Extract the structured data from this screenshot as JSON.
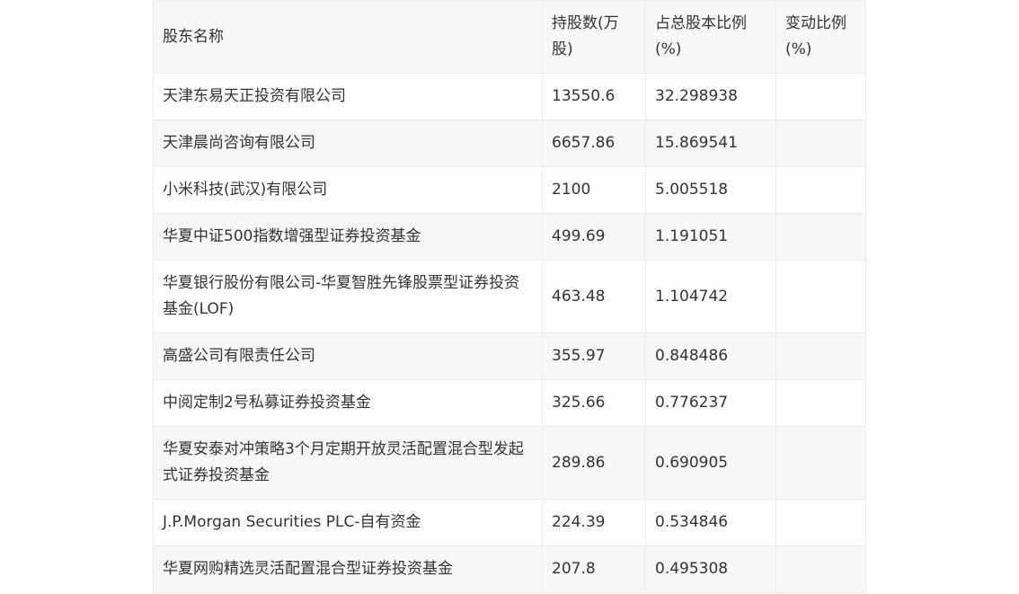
{
  "table": {
    "headers": [
      "股东名称",
      "持股数(万股)",
      "占总股本比例(%)",
      "变动比例(%)"
    ],
    "rows": [
      [
        "天津东易天正投资有限公司",
        "13550.6",
        "32.298938",
        ""
      ],
      [
        "天津晨尚咨询有限公司",
        "6657.86",
        "15.869541",
        ""
      ],
      [
        "小米科技(武汉)有限公司",
        "2100",
        "5.005518",
        ""
      ],
      [
        "华夏中证500指数增强型证券投资基金",
        "499.69",
        "1.191051",
        ""
      ],
      [
        "华夏银行股份有限公司-华夏智胜先锋股票型证券投资基金(LOF)",
        "463.48",
        "1.104742",
        ""
      ],
      [
        "高盛公司有限责任公司",
        "355.97",
        "0.848486",
        ""
      ],
      [
        "中阅定制2号私募证券投资基金",
        "325.66",
        "0.776237",
        ""
      ],
      [
        "华夏安泰对冲策略3个月定期开放灵活配置混合型发起式证券投资基金",
        "289.86",
        "0.690905",
        ""
      ],
      [
        "J.P.Morgan Securities PLC-自有资金",
        "224.39",
        "0.534846",
        ""
      ],
      [
        "华夏网购精选灵活配置混合型证券投资基金",
        "207.8",
        "0.495308",
        ""
      ]
    ]
  }
}
